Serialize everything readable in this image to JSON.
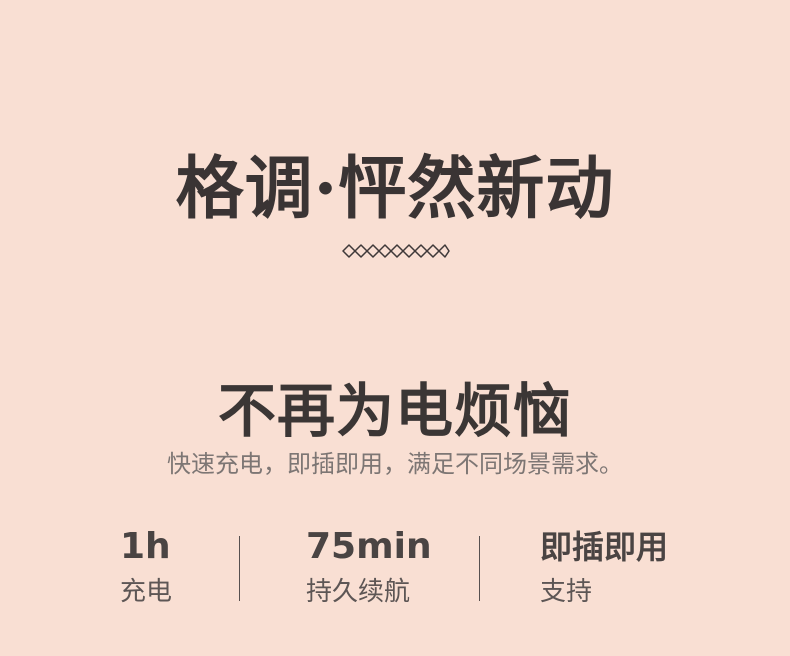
{
  "colors": {
    "background": "#f9dfd3",
    "primary_text": "#333333",
    "secondary_text": "#7d7674",
    "divider": "#575050"
  },
  "hero": {
    "title": "格调·怦然新动"
  },
  "headline": {
    "title": "不再为电烦恼",
    "description": "快速充电，即插即用，满足不同场景需求。"
  },
  "stats": [
    {
      "value": "1h",
      "label": "充电"
    },
    {
      "value": "75min",
      "label": "持久续航"
    },
    {
      "value": "即插即用",
      "label": "支持"
    }
  ],
  "divider": {
    "icon": "diamond-pattern-icon"
  }
}
